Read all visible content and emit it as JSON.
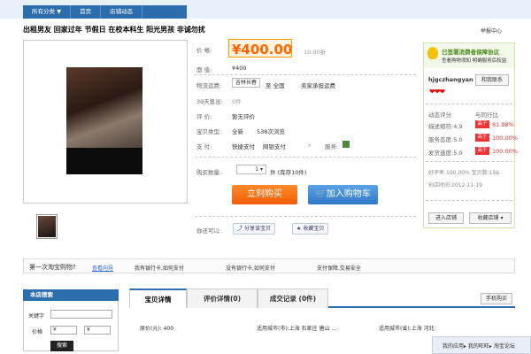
{
  "nav": {
    "items": [
      "所有分类 ▼",
      "首页",
      "店铺动态"
    ]
  },
  "title": "出租男友 回家过年 节假日 在校本科生 阳光男孩 非诚勿扰",
  "report": "举报中心",
  "price": {
    "label": "价 格:",
    "value": "¥400.00",
    "sales_hint": "10.00折"
  },
  "promo": {
    "label": "面 值:",
    "value": "¥400"
  },
  "shipping": {
    "label": "物流运费:",
    "from": "吉林长春",
    "to_label": "至 全国",
    "note": "卖家承担运费"
  },
  "sold": {
    "label": "30天售出:",
    "value": "0件"
  },
  "review": {
    "label": "评 价:",
    "value": "暂无评价"
  },
  "popularity": {
    "label": "宝贝类型:",
    "value": "全新",
    "views": "538次浏览"
  },
  "payment": {
    "label": "支 付:",
    "options": [
      "快捷支付",
      "网银支付",
      "×"
    ],
    "service_label": "服务:"
  },
  "quantity": {
    "label": "购买数量:",
    "value": "1",
    "stock": "件 (库存10件)"
  },
  "buttons": {
    "buy": "立刻购买",
    "cart": "加入购物车"
  },
  "share": {
    "label": "你还可以:",
    "share_btn": "分享该宝贝",
    "fav_btn": "收藏宝贝"
  },
  "seller": {
    "protect_line1": "已签署消费者保障协议",
    "protect_line2": "查看购物须知 明确服务后权益",
    "name": "hjgczhangyan",
    "wangwang": "和我联系",
    "rating_title": "动态评分",
    "compare_title": "与同行比",
    "ratings": [
      {
        "label": "描述相符:4.9",
        "badge": "高于",
        "pct": "81.98%"
      },
      {
        "label": "服务态度:5.0",
        "badge": "高于",
        "pct": "100.00%"
      },
      {
        "label": "发货速度:5.0",
        "badge": "高于",
        "pct": "100.00%"
      }
    ],
    "good_rate": "好评率:100.00% 宝贝数:156",
    "created": "创店时间:2012-11-19",
    "enter_shop": "进入店铺",
    "fav_shop": "收藏店铺"
  },
  "tipbar": {
    "first": "第一次淘宝购物?",
    "first_link": "查看向导",
    "items": [
      "我有银行卡,如何支付",
      "没有银行卡,如何支付",
      "支付保障,交易安全"
    ]
  },
  "shopsearch": {
    "title": "本店搜索",
    "keyword_label": "关键字",
    "price_label": "价格",
    "yen1": "¥",
    "yen2": "¥",
    "btn": "搜索"
  },
  "tabs": [
    "宝贝详情",
    "评价详情(0)",
    "成交记录 (0件)"
  ],
  "details": {
    "original_price": "原价(元): 400",
    "city1": "适用城市(市):上海 石家庄 唐山 ...",
    "city2": "适用城市(省):上海 河北",
    "phone_btn": "手机购买"
  },
  "bottom": {
    "text": "我的应用▸ 我的旺旺▸ 淘宝论坛"
  }
}
